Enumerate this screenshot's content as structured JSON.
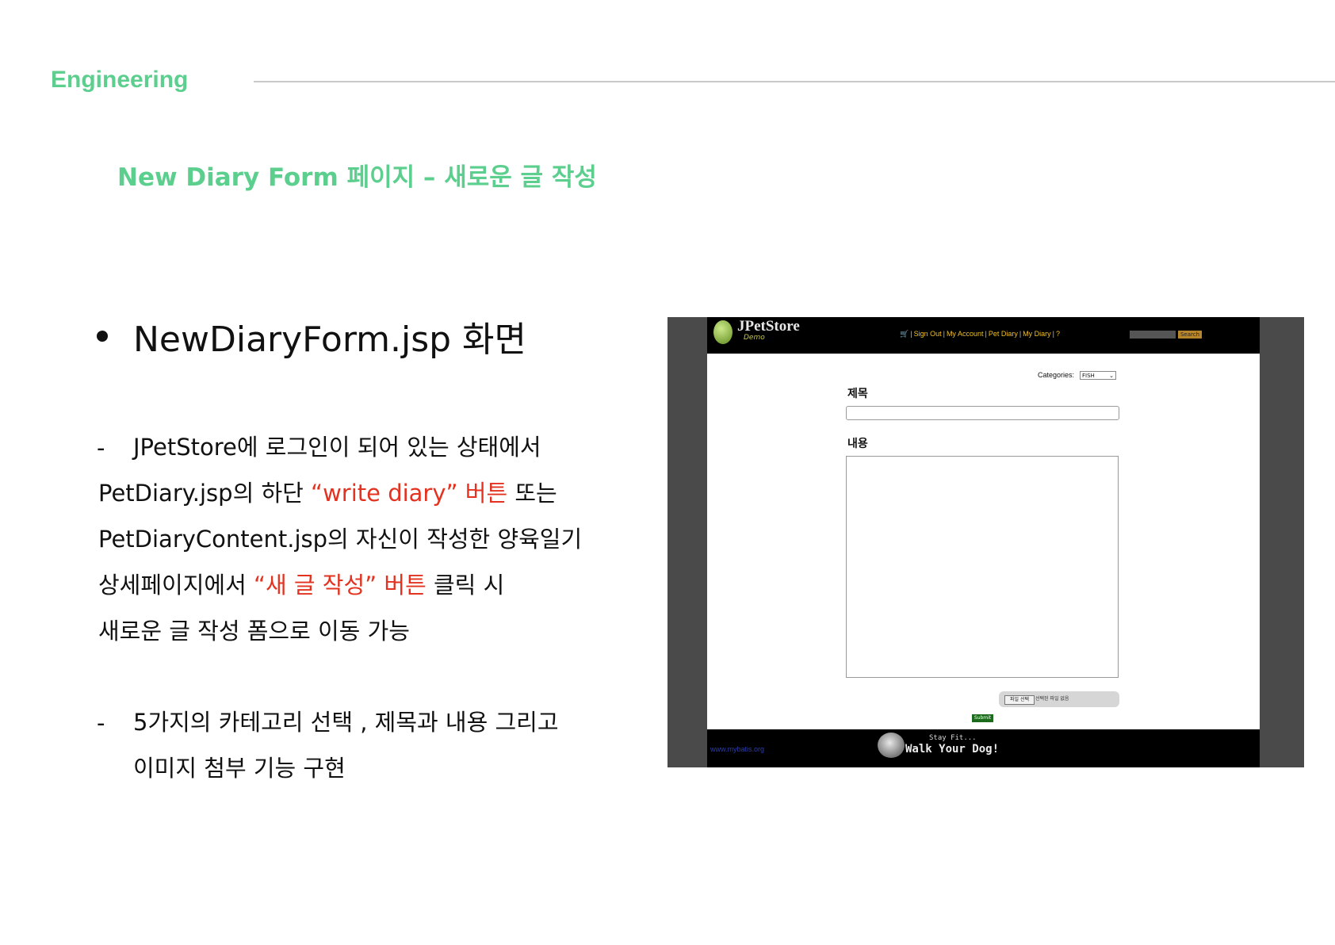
{
  "slide": {
    "section": "Engineering",
    "title": "New Diary Form 페이지 – 새로운 글 작성",
    "bullet": "NewDiaryForm.jsp 화면",
    "dash": "-",
    "para1": {
      "l1": "JPetStore에 로그인이 되어 있는 상태에서",
      "l2a": "PetDiary.jsp의 하단 ",
      "l2b": "“write diary” 버튼",
      "l2c": " 또는",
      "l3": "PetDiaryContent.jsp의 자신이 작성한 양육일기",
      "l4a": "상세페이지에서 ",
      "l4b": "“새 글 작성” 버튼",
      "l4c": " 클릭 시",
      "l5": "새로운 글 작성 폼으로 이동 가능"
    },
    "para2": {
      "l1": "5가지의 카테고리 선택 , 제목과 내용 그리고",
      "l2": "이미지 첨부 기능 구현"
    },
    "accent_color": "#5ccf8e",
    "highlight_color": "#e3321f"
  },
  "screenshot": {
    "logo_title": "JPetStore",
    "logo_sub": "Demo",
    "menu": {
      "cart_icon": "cart-icon",
      "sign_out": "Sign Out",
      "my_account": "My Account",
      "pet_diary": "Pet Diary",
      "my_diary": "My Diary",
      "help": "?"
    },
    "search_button": "Search",
    "categories_label": "Categories:",
    "category_value": "FISH",
    "title_label": "제목",
    "content_label": "내용",
    "file_button": "파일 선택",
    "file_status": "선택된 파일 없음",
    "submit": "Submit",
    "footer_link": "www.mybatis.org",
    "footer_small": "Stay Fit...",
    "footer_big": "Walk Your Dog!"
  }
}
